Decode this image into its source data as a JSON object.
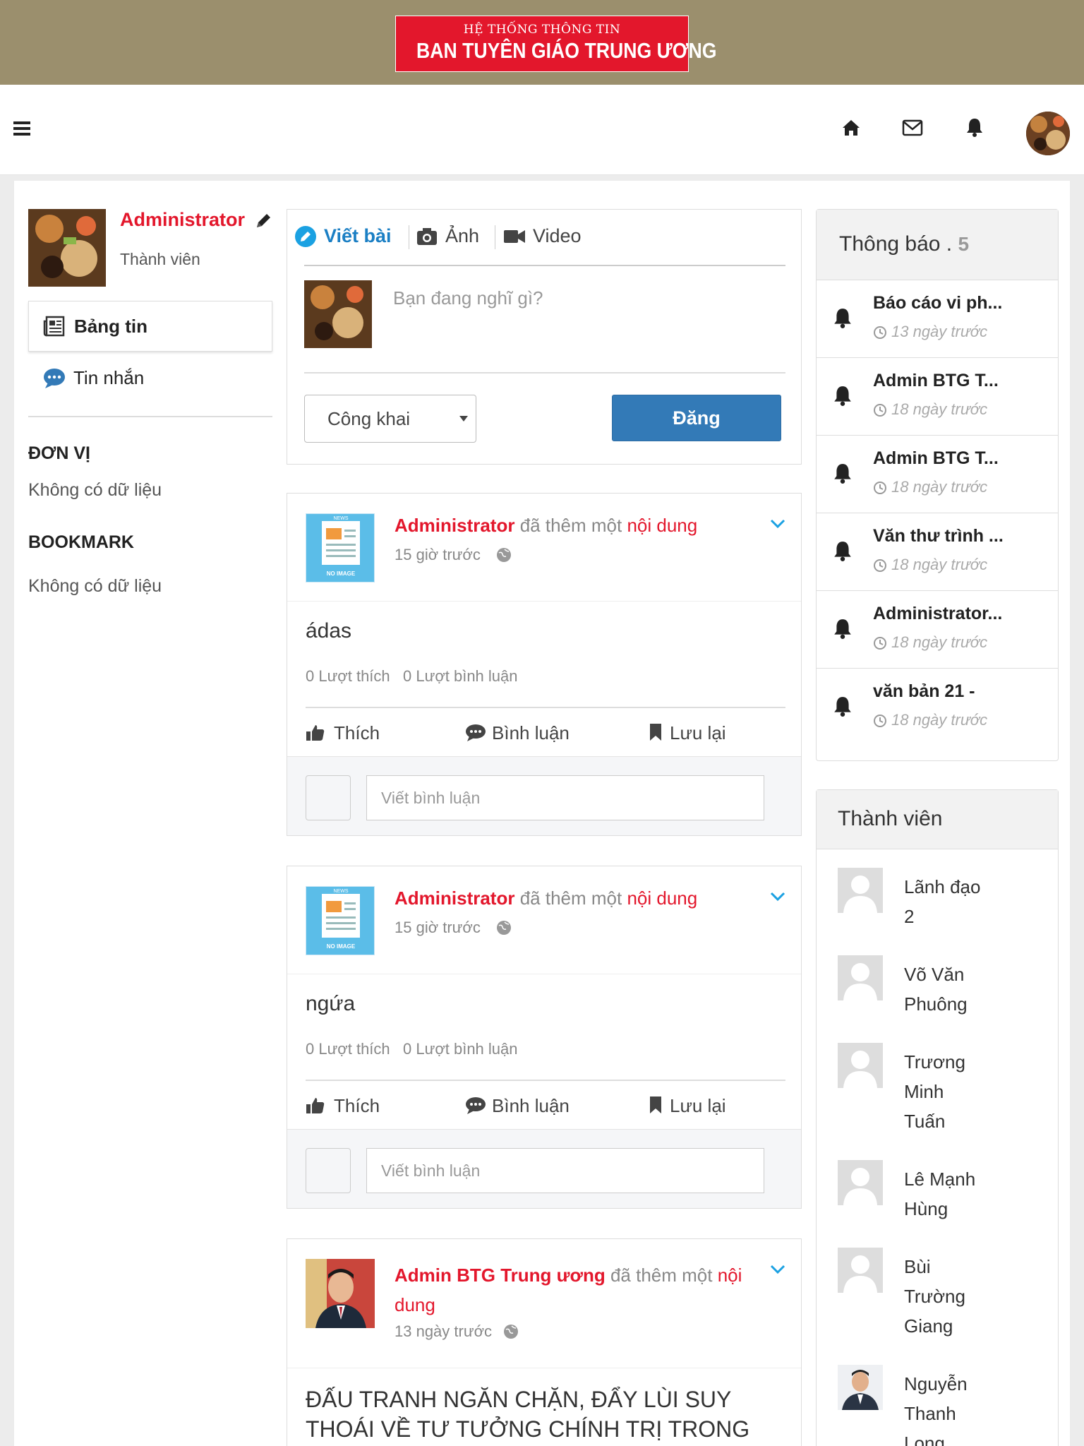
{
  "banner": {
    "line1": "HỆ THỐNG THÔNG TIN",
    "line2": "BAN TUYÊN GIÁO TRUNG ƯƠNG"
  },
  "colors": {
    "brand_red": "#e3172c",
    "banner_bg": "#9b8f6d",
    "primary_blue": "#337ab7",
    "icon_blue": "#1ba1e2"
  },
  "sidebar": {
    "user_name": "Administrator",
    "user_role": "Thành viên",
    "nav": [
      {
        "label": "Bảng tin",
        "icon": "newspaper-icon"
      },
      {
        "label": "Tin nhắn",
        "icon": "chat-icon"
      }
    ],
    "unit_title": "ĐƠN VỊ",
    "unit_empty": "Không có dữ liệu",
    "bookmark_title": "BOOKMARK",
    "bookmark_empty": "Không có dữ liệu"
  },
  "composer": {
    "tabs": [
      {
        "label": "Viết bài",
        "icon": "pencil-icon"
      },
      {
        "label": "Ảnh",
        "icon": "camera-icon"
      },
      {
        "label": "Video",
        "icon": "video-icon"
      }
    ],
    "placeholder": "Bạn đang nghĩ gì?",
    "privacy": "Công khai",
    "submit": "Đăng"
  },
  "posts": [
    {
      "author": "Administrator",
      "action": "đã thêm một",
      "object": "nội dung",
      "time": "15 giờ trước",
      "content": "ádas",
      "likes": "0 Lượt thích",
      "comments": "0 Lượt bình luận",
      "like_label": "Thích",
      "comment_label": "Bình luận",
      "save_label": "Lưu lại",
      "comment_placeholder": "Viết bình luận",
      "thumb_top": "NEWS",
      "thumb_bottom": "NO IMAGE"
    },
    {
      "author": "Administrator",
      "action": "đã thêm một",
      "object": "nội dung",
      "time": "15 giờ trước",
      "content": "ngứa",
      "likes": "0 Lượt thích",
      "comments": "0 Lượt bình luận",
      "like_label": "Thích",
      "comment_label": "Bình luận",
      "save_label": "Lưu lại",
      "comment_placeholder": "Viết bình luận",
      "thumb_top": "NEWS",
      "thumb_bottom": "NO IMAGE"
    },
    {
      "author": "Admin BTG Trung ương",
      "action": "đã thêm một",
      "object": "nội dung",
      "time": "13 ngày trước",
      "content": "ĐẤU TRANH NGĂN CHẶN, ĐẨY LÙI SUY THOÁI VỀ TƯ TƯỞNG CHÍNH TRỊ TRONG"
    }
  ],
  "notifications": {
    "title": "Thông báo .",
    "count": "5",
    "items": [
      {
        "text": "Báo cáo vi ph...",
        "time": "13 ngày trước"
      },
      {
        "text": "Admin BTG T...",
        "time": "18 ngày trước"
      },
      {
        "text": "Admin BTG T...",
        "time": "18 ngày trước"
      },
      {
        "text": "Văn thư trình ...",
        "time": "18 ngày trước"
      },
      {
        "text": "Administrator...",
        "time": "18 ngày trước"
      },
      {
        "text": "văn bản 21 -",
        "time": "18 ngày trước"
      }
    ]
  },
  "members": {
    "title": "Thành viên",
    "items": [
      {
        "l1": "Lãnh đạo",
        "l2": "2",
        "l3": ""
      },
      {
        "l1": "Võ Văn",
        "l2": "Phuông",
        "l3": ""
      },
      {
        "l1": "Trương",
        "l2": "Minh",
        "l3": "Tuấn"
      },
      {
        "l1": "Lê Mạnh",
        "l2": "Hùng",
        "l3": ""
      },
      {
        "l1": "Bùi",
        "l2": "Trường",
        "l3": "Giang"
      },
      {
        "l1": "Nguyễn",
        "l2": "Thanh",
        "l3": "Long"
      }
    ]
  }
}
